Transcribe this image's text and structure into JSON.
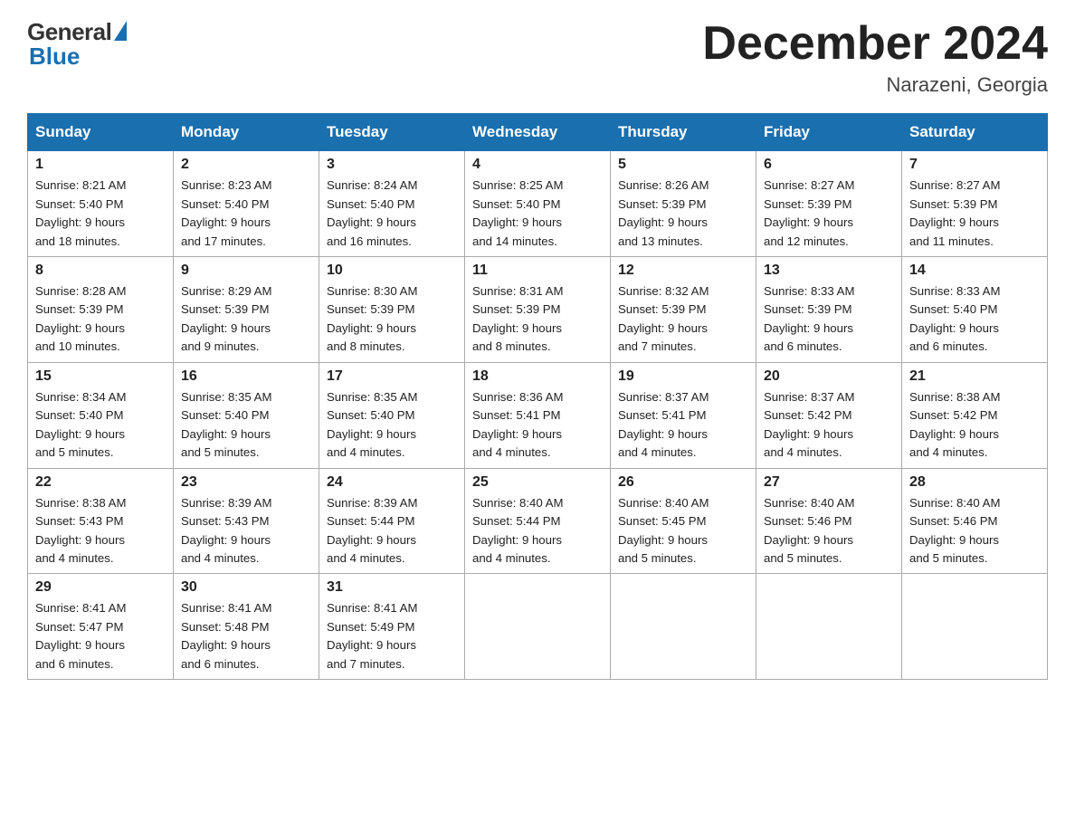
{
  "logo": {
    "general": "General",
    "triangle": "",
    "blue": "Blue"
  },
  "title": "December 2024",
  "location": "Narazeni, Georgia",
  "days_of_week": [
    "Sunday",
    "Monday",
    "Tuesday",
    "Wednesday",
    "Thursday",
    "Friday",
    "Saturday"
  ],
  "weeks": [
    [
      {
        "day": "1",
        "info": "Sunrise: 8:21 AM\nSunset: 5:40 PM\nDaylight: 9 hours\nand 18 minutes."
      },
      {
        "day": "2",
        "info": "Sunrise: 8:23 AM\nSunset: 5:40 PM\nDaylight: 9 hours\nand 17 minutes."
      },
      {
        "day": "3",
        "info": "Sunrise: 8:24 AM\nSunset: 5:40 PM\nDaylight: 9 hours\nand 16 minutes."
      },
      {
        "day": "4",
        "info": "Sunrise: 8:25 AM\nSunset: 5:40 PM\nDaylight: 9 hours\nand 14 minutes."
      },
      {
        "day": "5",
        "info": "Sunrise: 8:26 AM\nSunset: 5:39 PM\nDaylight: 9 hours\nand 13 minutes."
      },
      {
        "day": "6",
        "info": "Sunrise: 8:27 AM\nSunset: 5:39 PM\nDaylight: 9 hours\nand 12 minutes."
      },
      {
        "day": "7",
        "info": "Sunrise: 8:27 AM\nSunset: 5:39 PM\nDaylight: 9 hours\nand 11 minutes."
      }
    ],
    [
      {
        "day": "8",
        "info": "Sunrise: 8:28 AM\nSunset: 5:39 PM\nDaylight: 9 hours\nand 10 minutes."
      },
      {
        "day": "9",
        "info": "Sunrise: 8:29 AM\nSunset: 5:39 PM\nDaylight: 9 hours\nand 9 minutes."
      },
      {
        "day": "10",
        "info": "Sunrise: 8:30 AM\nSunset: 5:39 PM\nDaylight: 9 hours\nand 8 minutes."
      },
      {
        "day": "11",
        "info": "Sunrise: 8:31 AM\nSunset: 5:39 PM\nDaylight: 9 hours\nand 8 minutes."
      },
      {
        "day": "12",
        "info": "Sunrise: 8:32 AM\nSunset: 5:39 PM\nDaylight: 9 hours\nand 7 minutes."
      },
      {
        "day": "13",
        "info": "Sunrise: 8:33 AM\nSunset: 5:39 PM\nDaylight: 9 hours\nand 6 minutes."
      },
      {
        "day": "14",
        "info": "Sunrise: 8:33 AM\nSunset: 5:40 PM\nDaylight: 9 hours\nand 6 minutes."
      }
    ],
    [
      {
        "day": "15",
        "info": "Sunrise: 8:34 AM\nSunset: 5:40 PM\nDaylight: 9 hours\nand 5 minutes."
      },
      {
        "day": "16",
        "info": "Sunrise: 8:35 AM\nSunset: 5:40 PM\nDaylight: 9 hours\nand 5 minutes."
      },
      {
        "day": "17",
        "info": "Sunrise: 8:35 AM\nSunset: 5:40 PM\nDaylight: 9 hours\nand 4 minutes."
      },
      {
        "day": "18",
        "info": "Sunrise: 8:36 AM\nSunset: 5:41 PM\nDaylight: 9 hours\nand 4 minutes."
      },
      {
        "day": "19",
        "info": "Sunrise: 8:37 AM\nSunset: 5:41 PM\nDaylight: 9 hours\nand 4 minutes."
      },
      {
        "day": "20",
        "info": "Sunrise: 8:37 AM\nSunset: 5:42 PM\nDaylight: 9 hours\nand 4 minutes."
      },
      {
        "day": "21",
        "info": "Sunrise: 8:38 AM\nSunset: 5:42 PM\nDaylight: 9 hours\nand 4 minutes."
      }
    ],
    [
      {
        "day": "22",
        "info": "Sunrise: 8:38 AM\nSunset: 5:43 PM\nDaylight: 9 hours\nand 4 minutes."
      },
      {
        "day": "23",
        "info": "Sunrise: 8:39 AM\nSunset: 5:43 PM\nDaylight: 9 hours\nand 4 minutes."
      },
      {
        "day": "24",
        "info": "Sunrise: 8:39 AM\nSunset: 5:44 PM\nDaylight: 9 hours\nand 4 minutes."
      },
      {
        "day": "25",
        "info": "Sunrise: 8:40 AM\nSunset: 5:44 PM\nDaylight: 9 hours\nand 4 minutes."
      },
      {
        "day": "26",
        "info": "Sunrise: 8:40 AM\nSunset: 5:45 PM\nDaylight: 9 hours\nand 5 minutes."
      },
      {
        "day": "27",
        "info": "Sunrise: 8:40 AM\nSunset: 5:46 PM\nDaylight: 9 hours\nand 5 minutes."
      },
      {
        "day": "28",
        "info": "Sunrise: 8:40 AM\nSunset: 5:46 PM\nDaylight: 9 hours\nand 5 minutes."
      }
    ],
    [
      {
        "day": "29",
        "info": "Sunrise: 8:41 AM\nSunset: 5:47 PM\nDaylight: 9 hours\nand 6 minutes."
      },
      {
        "day": "30",
        "info": "Sunrise: 8:41 AM\nSunset: 5:48 PM\nDaylight: 9 hours\nand 6 minutes."
      },
      {
        "day": "31",
        "info": "Sunrise: 8:41 AM\nSunset: 5:49 PM\nDaylight: 9 hours\nand 7 minutes."
      },
      null,
      null,
      null,
      null
    ]
  ]
}
